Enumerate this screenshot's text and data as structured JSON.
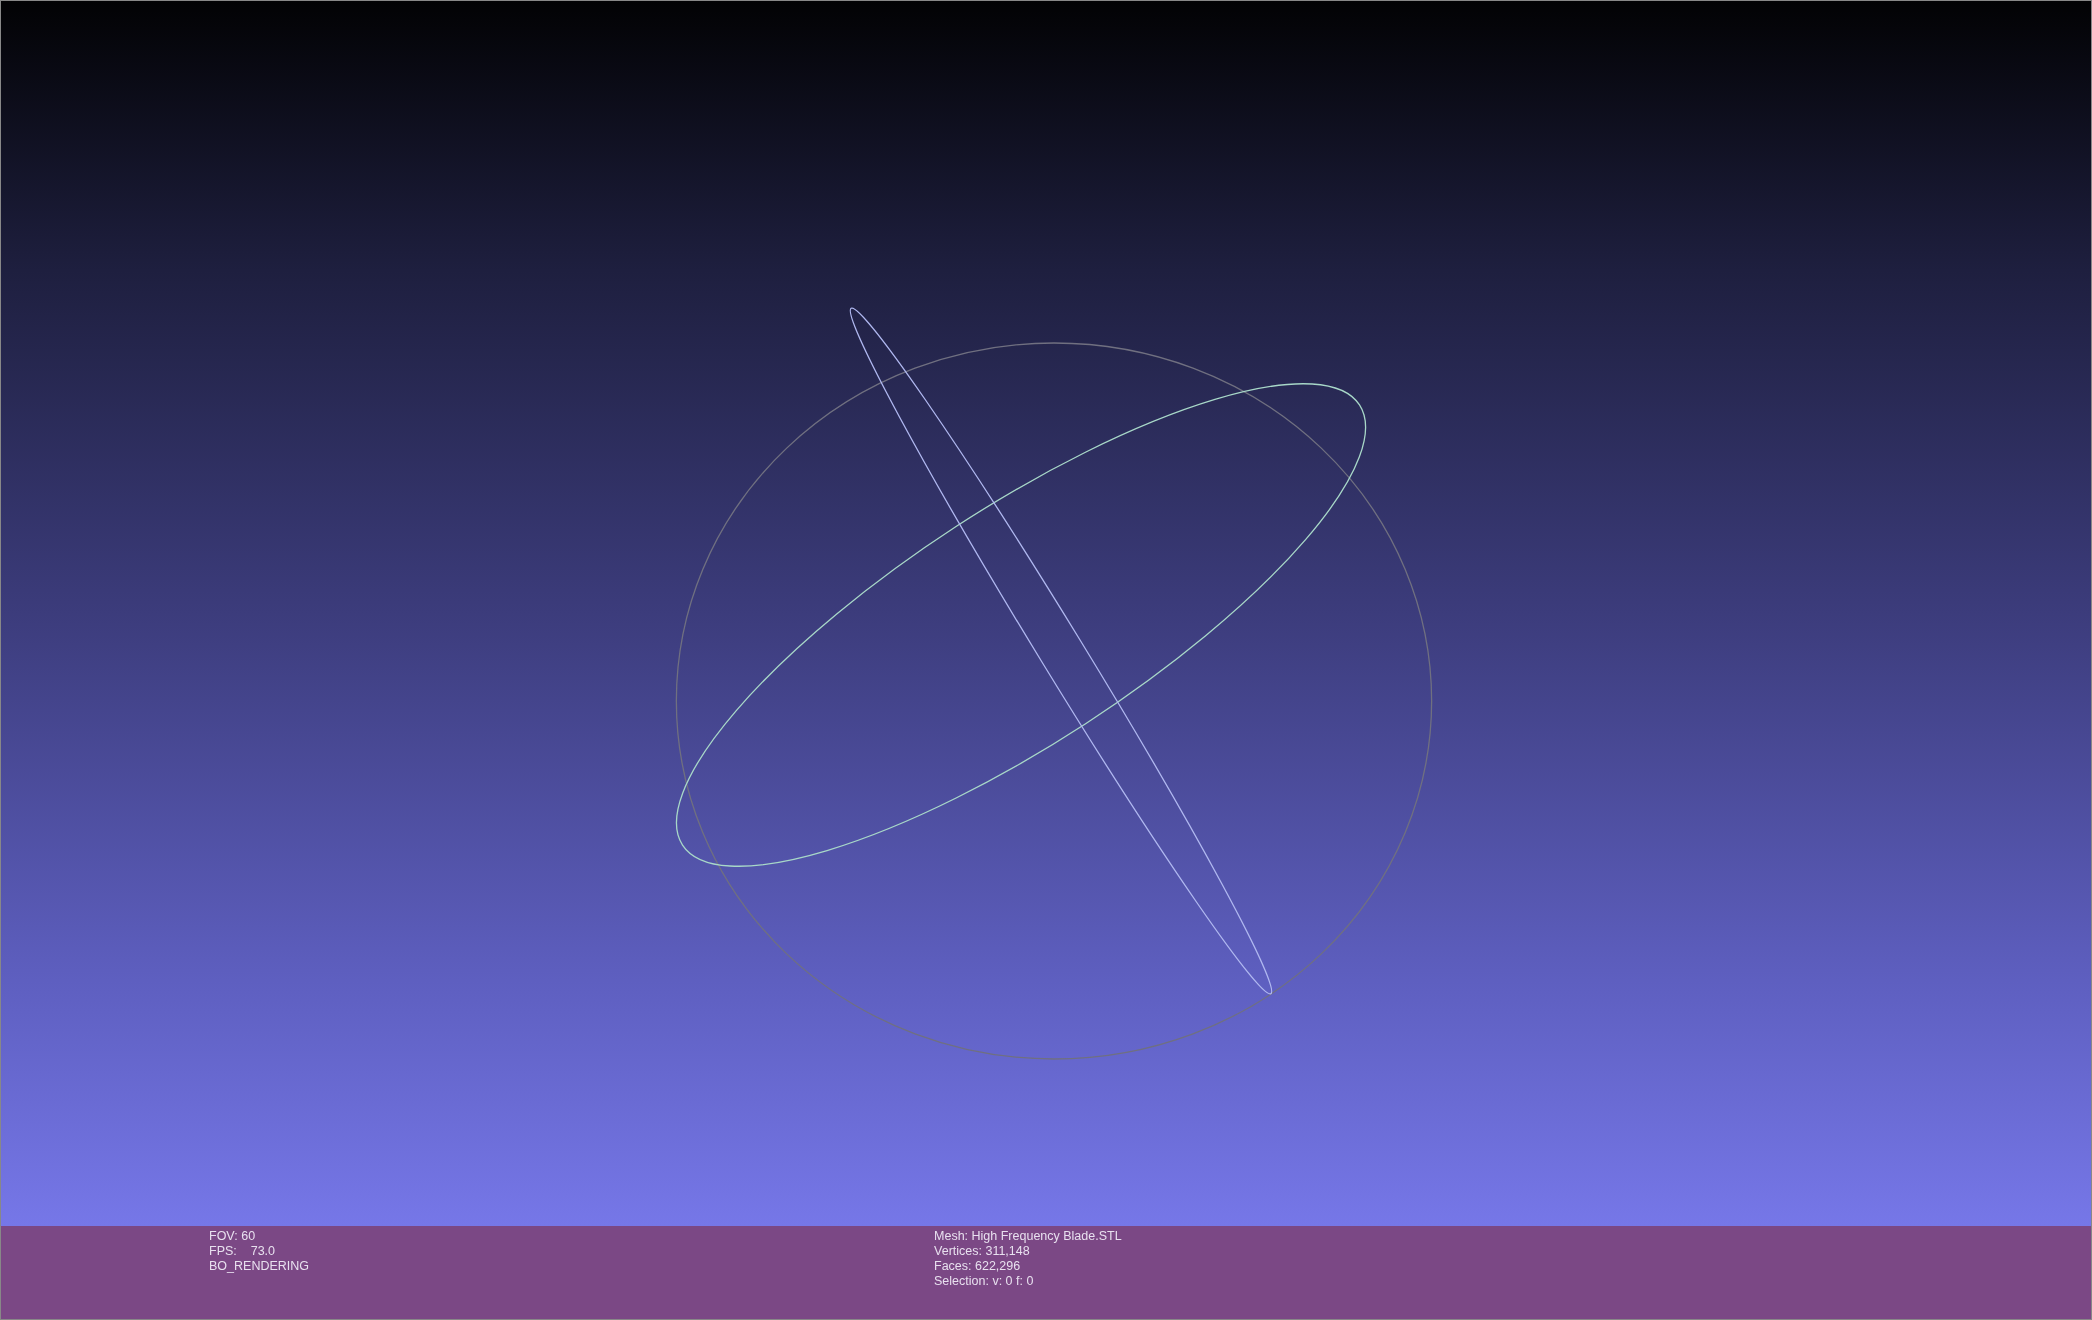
{
  "viewport": {
    "kind": "trackball"
  },
  "info_bar": {
    "left_lines": [
      "FOV: 60",
      "FPS:    73.0",
      "BO_RENDERING"
    ],
    "right_lines": [
      "Mesh: High Frequency Blade.STL",
      "Vertices: 311,148",
      "Faces: 622,296",
      "Selection: v: 0 f: 0"
    ]
  }
}
